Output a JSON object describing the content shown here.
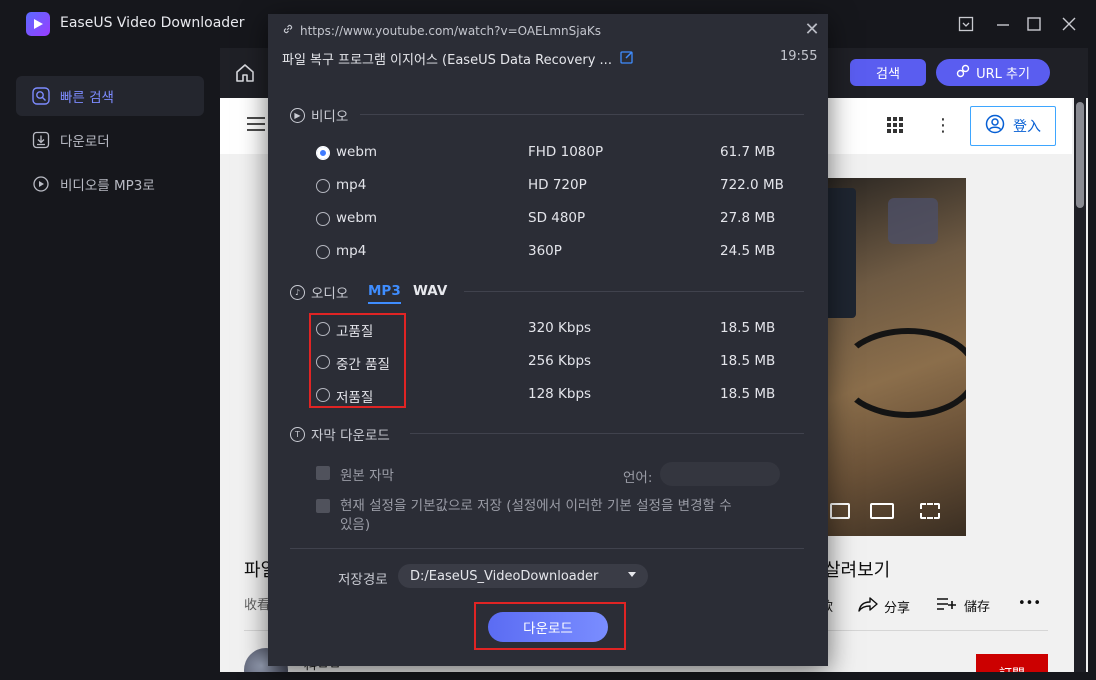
{
  "app": {
    "title": "EaseUS Video Downloader",
    "window_controls": [
      "minimize-to-tray-icon",
      "minimize-icon",
      "maximize-icon",
      "close-icon"
    ]
  },
  "sidebar": {
    "items": [
      {
        "label": "빠른 검색",
        "icon": "search-icon",
        "active": true
      },
      {
        "label": "다운로더",
        "icon": "download-icon",
        "active": false
      },
      {
        "label": "비디오를 MP3로",
        "icon": "convert-icon",
        "active": false
      }
    ]
  },
  "browser": {
    "search_label": "검색",
    "url_add_label": "URL 추기",
    "login_label": "登入",
    "video_title_left": "파일",
    "video_title_right": "살려보기",
    "video_meta": "收看",
    "actions": {
      "partial": "款",
      "share": "分享",
      "save": "儲存"
    },
    "channel_name": "科ㅁㅁ",
    "subscribe_label": "訂閱"
  },
  "dialog": {
    "url": "https://www.youtube.com/watch?v=OAELmnSjaKs",
    "title": "파일 복구 프로그램 이지어스 (EaseUS Data Recovery ...",
    "duration": "19:55",
    "video_section": {
      "heading": "비디오",
      "rows": [
        {
          "format": "webm",
          "quality": "FHD 1080P",
          "size": "61.7 MB",
          "selected": true
        },
        {
          "format": "mp4",
          "quality": "HD 720P",
          "size": "722.0 MB",
          "selected": false
        },
        {
          "format": "webm",
          "quality": "SD 480P",
          "size": "27.8 MB",
          "selected": false
        },
        {
          "format": "mp4",
          "quality": "360P",
          "size": "24.5 MB",
          "selected": false
        }
      ]
    },
    "audio_section": {
      "heading": "오디오",
      "tabs": [
        "MP3",
        "WAV"
      ],
      "active_tab": "MP3",
      "rows": [
        {
          "quality": "고품질",
          "bitrate": "320 Kbps",
          "size": "18.5 MB"
        },
        {
          "quality": "중간 품질",
          "bitrate": "256 Kbps",
          "size": "18.5 MB"
        },
        {
          "quality": "저품질",
          "bitrate": "128 Kbps",
          "size": "18.5 MB"
        }
      ]
    },
    "subtitle_section": {
      "heading": "자막 다운로드",
      "original_subtitle": "원본 자막",
      "language_label": "언어:",
      "save_default_line1": "현재 설정을 기본값으로 저장 (설정에서 이러한 기본 설정을 변경할 수",
      "save_default_line2": "있음)"
    },
    "save_path_label": "저장경로",
    "save_path_value": "D:/EaseUS_VideoDownloader",
    "download_label": "다운로드"
  },
  "colors": {
    "accent": "#5a5df0",
    "highlight_box": "#e02424",
    "selected_radio": "#3f7bff",
    "active_tab": "#3f8dff"
  }
}
